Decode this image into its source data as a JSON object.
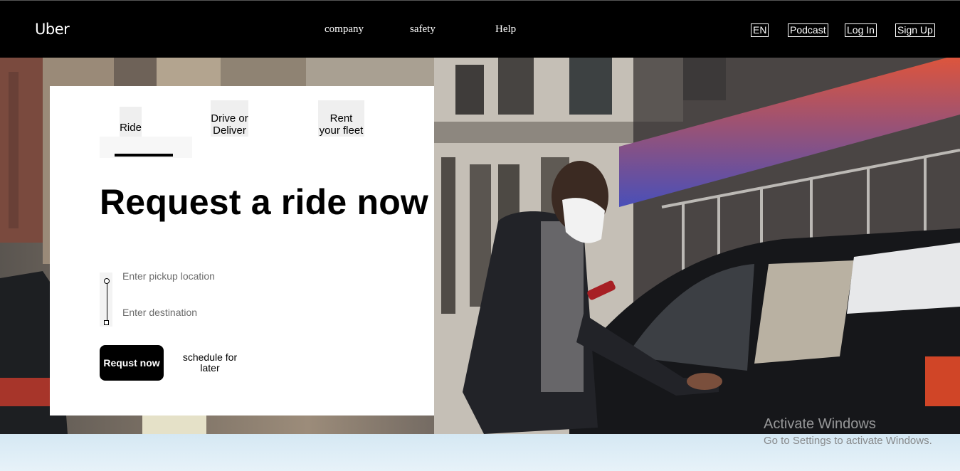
{
  "header": {
    "logo": "Uber",
    "nav": [
      "company",
      "safety",
      "Help"
    ],
    "buttons": [
      "EN",
      "Podcast",
      "Log In",
      "Sign Up"
    ]
  },
  "tabs": [
    {
      "label": "Ride",
      "active": true
    },
    {
      "label": "Drive or Deliver",
      "active": false
    },
    {
      "label": "Rent your fleet",
      "active": false
    }
  ],
  "card": {
    "title": "Request a ride now",
    "pickup_placeholder": "Enter pickup location",
    "pickup_value": "",
    "destination_placeholder": "Enter destination",
    "destination_value": "",
    "request_button": "Requst now",
    "schedule_button": "schedule for later"
  },
  "hero": {
    "image_alt": "Man in a face mask opening the door of a black car on a city street"
  },
  "watermark": {
    "line1": "Activate Windows",
    "line2": "Go to Settings to activate Windows."
  },
  "colors": {
    "header_bg": "#000000",
    "card_bg": "#ffffff",
    "primary_button": "#000000",
    "awning_top": "#e0553a",
    "awning_bottom": "#4a4fb8"
  }
}
